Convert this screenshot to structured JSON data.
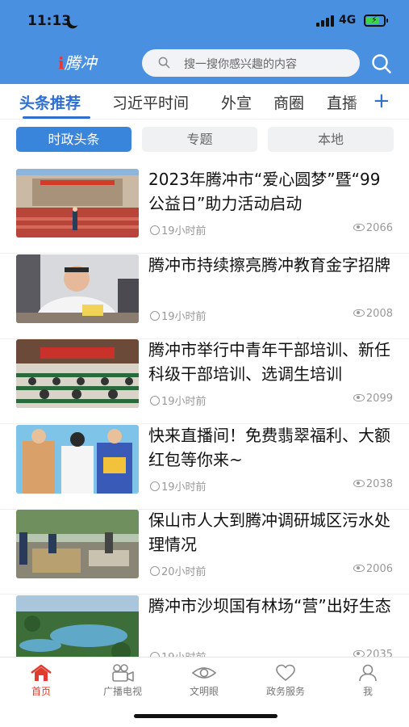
{
  "status_bar": {
    "time": "11:13",
    "network": "4G",
    "battery_level": 0.75
  },
  "header": {
    "logo_text": "腾冲",
    "logo_prefix": "i",
    "search": {
      "placeholder": "搜一搜你感兴趣的内容"
    }
  },
  "tabs": [
    {
      "label": "头条推荐",
      "active": true
    },
    {
      "label": "习近平时间",
      "active": false
    },
    {
      "label": "外宣",
      "active": false
    },
    {
      "label": "商圈",
      "active": false
    },
    {
      "label": "直播",
      "active": false
    }
  ],
  "add_tab_symbol": "+",
  "subtabs": [
    {
      "label": "时政头条",
      "active": true
    },
    {
      "label": "专题",
      "active": false
    },
    {
      "label": "本地",
      "active": false
    }
  ],
  "news": [
    {
      "title": "2023年腾冲市“爱心圆梦”暨“99公益日”助力活动启动",
      "time": "19小时前",
      "views": "2066",
      "thumb_icon": "building-ceremony-photo"
    },
    {
      "title": "腾冲市持续擦亮腾冲教育金字招牌",
      "time": "19小时前",
      "views": "2008",
      "thumb_icon": "meeting-speaker-photo"
    },
    {
      "title": "腾冲市举行中青年干部培训、新任科级干部培训、选调生培训",
      "time": "19小时前",
      "views": "2099",
      "thumb_icon": "training-hall-photo"
    },
    {
      "title": "快来直播间！免费翡翠福利、大额红包等你来~",
      "time": "19小时前",
      "views": "2038",
      "thumb_icon": "livestream-hosts-photo"
    },
    {
      "title": "保山市人大到腾冲调研城区污水处理情况",
      "time": "20小时前",
      "views": "2006",
      "thumb_icon": "sewage-site-photo"
    },
    {
      "title": "腾冲市沙坝国有林场“营”出好生态",
      "time": "19小时前",
      "views": "2035",
      "thumb_icon": "forest-lake-photo"
    }
  ],
  "bottom_nav": [
    {
      "label": "首页",
      "icon": "home-icon",
      "active": true
    },
    {
      "label": "广播电视",
      "icon": "video-camera-icon",
      "active": false
    },
    {
      "label": "文明眼",
      "icon": "eye-icon",
      "active": false
    },
    {
      "label": "政务服务",
      "icon": "heart-icon",
      "active": false
    },
    {
      "label": "我",
      "icon": "user-icon",
      "active": false
    }
  ],
  "colors": {
    "header_blue": "#4a90e0",
    "accent_blue": "#2f6fd0",
    "active_red": "#e23a2e"
  }
}
